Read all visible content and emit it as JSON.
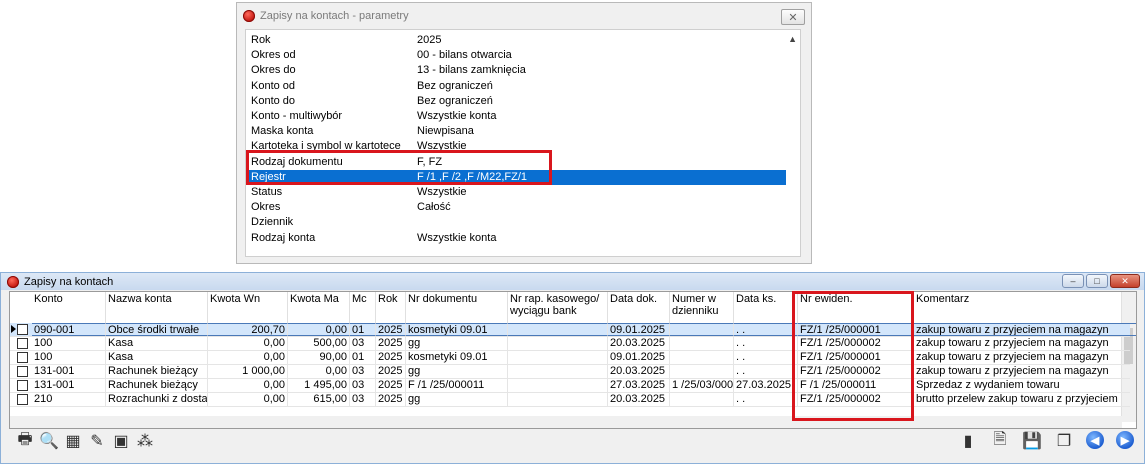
{
  "dialog": {
    "title": "Zapisy na kontach - parametry",
    "close_glyph": "✕",
    "rows": [
      {
        "k": "Rok",
        "v": "2025"
      },
      {
        "k": "Okres od",
        "v": "00 - bilans otwarcia"
      },
      {
        "k": "Okres do",
        "v": "13 - bilans zamknięcia"
      },
      {
        "k": "Konto od",
        "v": "Bez ograniczeń"
      },
      {
        "k": "Konto do",
        "v": "Bez ograniczeń"
      },
      {
        "k": "Konto - multiwybór",
        "v": "Wszystkie konta"
      },
      {
        "k": "Maska konta",
        "v": "Niewpisana"
      },
      {
        "k": "Kartoteka i symbol w kartotece",
        "v": "Wszystkie"
      },
      {
        "k": "Rodzaj dokumentu",
        "v": "F, FZ"
      },
      {
        "k": "Rejestr",
        "v": "F /1 ,F /2 ,F /M22,FZ/1"
      },
      {
        "k": "Status",
        "v": "Wszystkie"
      },
      {
        "k": "Okres",
        "v": "Całość"
      },
      {
        "k": "Dziennik",
        "v": ""
      },
      {
        "k": "Rodzaj konta",
        "v": "Wszystkie konta"
      }
    ],
    "selected_index": 9
  },
  "main": {
    "title": "Zapisy na kontach",
    "headers": [
      "Konto",
      "Nazwa konta",
      "Kwota Wn",
      "Kwota Ma",
      "Mc",
      "Rok",
      "Nr dokumentu",
      "Nr rap. kasowego/ wyciągu bank",
      "Data dok.",
      "Numer w dzienniku",
      "Data ks.",
      "Nr ewiden.",
      "Komentarz"
    ],
    "rows": [
      [
        "090-001",
        "Obce środki trwałe",
        "200,70",
        "0,00",
        "01",
        "2025",
        "kosmetyki 09.01",
        "",
        "09.01.2025",
        "",
        ". .",
        "FZ/1  /25/000001",
        "zakup towaru z przyjeciem na magazyn"
      ],
      [
        "100",
        "Kasa",
        "0,00",
        "500,00",
        "03",
        "2025",
        "gg",
        "",
        "20.03.2025",
        "",
        ". .",
        "FZ/1  /25/000002",
        "zakup towaru z przyjeciem na magazyn"
      ],
      [
        "100",
        "Kasa",
        "0,00",
        "90,00",
        "01",
        "2025",
        "kosmetyki 09.01",
        "",
        "09.01.2025",
        "",
        ". .",
        "FZ/1  /25/000001",
        "zakup towaru z przyjeciem na magazyn"
      ],
      [
        "131-001",
        "Rachunek bieżący",
        "1 000,00",
        "0,00",
        "03",
        "2025",
        "gg",
        "",
        "20.03.2025",
        "",
        ". .",
        "FZ/1  /25/000002",
        "zakup towaru z przyjeciem na magazyn"
      ],
      [
        "131-001",
        "Rachunek bieżący",
        "0,00",
        "1 495,00",
        "03",
        "2025",
        "F /1  /25/000011",
        "",
        "27.03.2025",
        "1 /25/03/000",
        "27.03.2025",
        "F /1  /25/000011",
        "Sprzedaz z wydaniem towaru"
      ],
      [
        "210",
        "Rozrachunki z dosta",
        "0,00",
        "615,00",
        "03",
        "2025",
        "gg",
        "",
        "20.03.2025",
        "",
        ". .",
        "FZ/1  /25/000002",
        "brutto przelew   zakup towaru z przyjeciem"
      ]
    ],
    "active_row": 0
  }
}
